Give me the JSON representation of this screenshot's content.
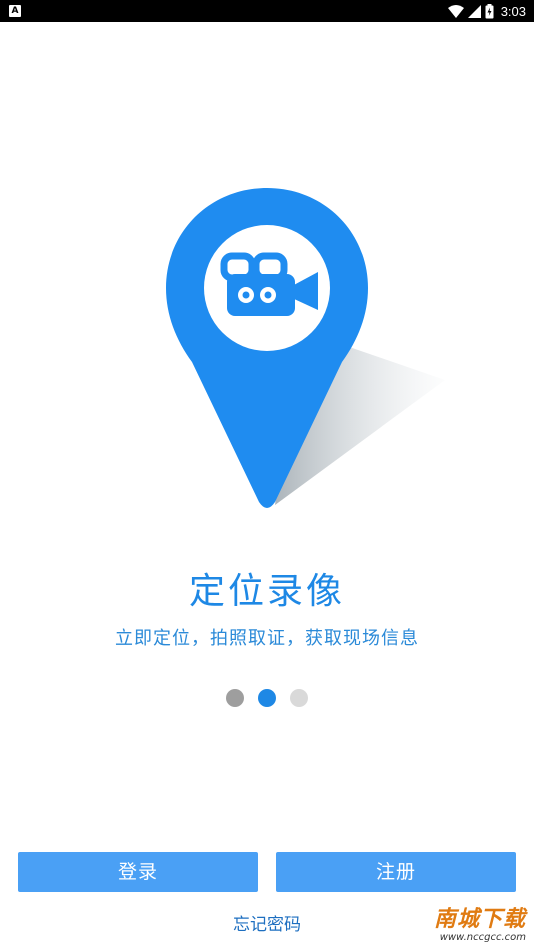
{
  "status_bar": {
    "time": "3:03",
    "notification_icon": "android-a-icon",
    "icons": [
      "wifi-icon",
      "signal-icon",
      "battery-charging-icon"
    ]
  },
  "onboarding": {
    "illustration_icon": "map-pin-camera-icon",
    "title": "定位录像",
    "subtitle": "立即定位，拍照取证，获取现场信息",
    "page_indicator": {
      "count": 3,
      "active_index": 1
    }
  },
  "actions": {
    "login_label": "登录",
    "register_label": "注册",
    "forgot_password_label": "忘记密码"
  },
  "watermark": {
    "main": "南城下载",
    "sub": "www.nccgcc.com"
  },
  "colors": {
    "accent": "#1e88e5",
    "button": "#4aa0f5",
    "pin": "#1f8cf0",
    "status_bar": "#000000"
  }
}
